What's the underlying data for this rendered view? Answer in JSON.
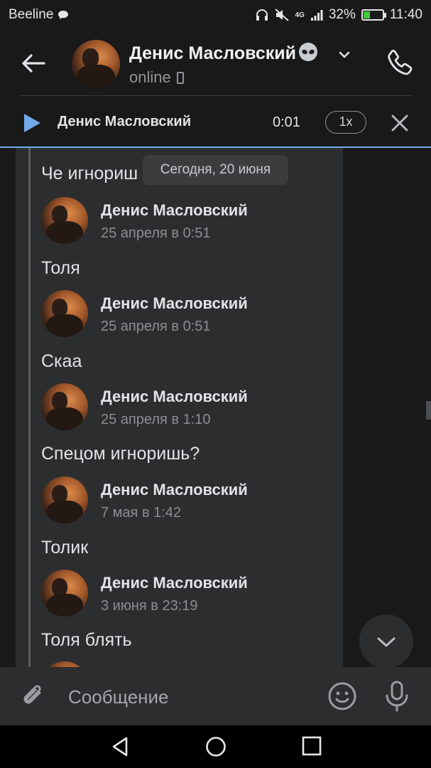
{
  "status_bar": {
    "carrier": "Beeline",
    "network": "4G",
    "battery_percent": "32%",
    "battery_level": 0.32,
    "time": "11:40"
  },
  "header": {
    "contact_name": "Денис Масловский",
    "status": "online",
    "icons": [
      "back-arrow-icon",
      "alien-emoji-icon",
      "chevron-down-icon",
      "phone-call-icon",
      "mobile-device-icon"
    ]
  },
  "player": {
    "track_name": "Денис Масловский",
    "time": "0:01",
    "speed": "1x"
  },
  "chat": {
    "date_divider": "Сегодня, 20 июня",
    "first_text": "Че игнориш",
    "messages": [
      {
        "author": "Денис Масловский",
        "date": "25 апреля в 0:51",
        "text": "Толя"
      },
      {
        "author": "Денис Масловский",
        "date": "25 апреля в 0:51",
        "text": "Скаа"
      },
      {
        "author": "Денис Масловский",
        "date": "25 апреля в 1:10",
        "text": "Спецом игноришь?"
      },
      {
        "author": "Денис Масловский",
        "date": "7 мая в 1:42",
        "text": "Толик"
      },
      {
        "author": "Денис Масловский",
        "date": "3 июня в 23:19",
        "text": "Толя блять"
      }
    ]
  },
  "compose": {
    "placeholder": "Сообщение"
  },
  "colors": {
    "background": "#19191a",
    "bubble": "#2c2d2e",
    "accent": "#71aaeb",
    "text": "#e1e3e6",
    "secondary_text": "#8b8e91"
  }
}
